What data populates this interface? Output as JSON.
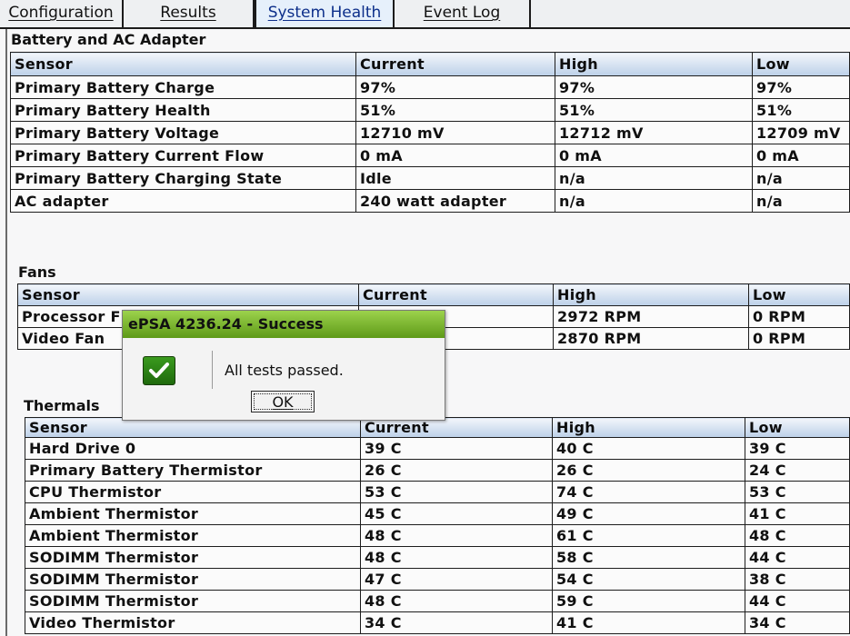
{
  "tabs": [
    {
      "label": "Configuration",
      "active": false
    },
    {
      "label": "Results",
      "active": false
    },
    {
      "label": "System Health",
      "active": true
    },
    {
      "label": "Event Log",
      "active": false
    }
  ],
  "battery": {
    "title": "Battery and AC Adapter",
    "headers": [
      "Sensor",
      "Current",
      "High",
      "Low"
    ],
    "rows": [
      [
        "Primary Battery Charge",
        "97%",
        "97%",
        "97%"
      ],
      [
        "Primary Battery Health",
        "51%",
        "51%",
        "51%"
      ],
      [
        "Primary Battery Voltage",
        "12710 mV",
        "12712 mV",
        "12709 mV"
      ],
      [
        "Primary Battery Current Flow",
        "0 mA",
        "0 mA",
        "0 mA"
      ],
      [
        "Primary Battery Charging State",
        "Idle",
        "n/a",
        "n/a"
      ],
      [
        "AC adapter",
        "240 watt adapter",
        "n/a",
        "n/a"
      ]
    ]
  },
  "fans": {
    "title": "Fans",
    "headers": [
      "Sensor",
      "Current",
      "High",
      "Low"
    ],
    "rows": [
      [
        "Processor F",
        "",
        "2972 RPM",
        "0 RPM"
      ],
      [
        "Video Fan",
        "",
        "2870 RPM",
        "0 RPM"
      ]
    ]
  },
  "thermals": {
    "title": "Thermals",
    "headers": [
      "Sensor",
      "Current",
      "High",
      "Low"
    ],
    "rows": [
      [
        "Hard Drive 0",
        "39 C",
        "40 C",
        "39 C"
      ],
      [
        "Primary Battery Thermistor",
        "26 C",
        "26 C",
        "24 C"
      ],
      [
        "CPU Thermistor",
        "53 C",
        "74 C",
        "53 C"
      ],
      [
        "Ambient Thermistor",
        "45 C",
        "49 C",
        "41 C"
      ],
      [
        "Ambient Thermistor",
        "48 C",
        "61 C",
        "48 C"
      ],
      [
        "SODIMM Thermistor",
        "48 C",
        "58 C",
        "44 C"
      ],
      [
        "SODIMM Thermistor",
        "47 C",
        "54 C",
        "38 C"
      ],
      [
        "SODIMM Thermistor",
        "48 C",
        "59 C",
        "44 C"
      ],
      [
        "Video Thermistor",
        "34 C",
        "41 C",
        "34 C"
      ]
    ]
  },
  "dialog": {
    "title": "ePSA 4236.24 - Success",
    "message": "All tests passed.",
    "ok_label": "OK",
    "icon": "checkmark-icon"
  },
  "colors": {
    "dialog_title_bar": "#6fae22",
    "table_header": "#c8d8ec",
    "active_tab_text": "#0d2f8a"
  }
}
